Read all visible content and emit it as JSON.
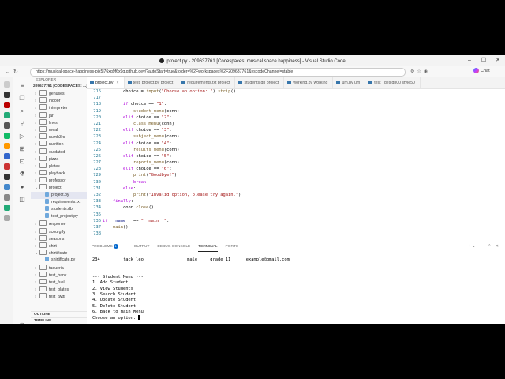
{
  "window": {
    "title": "project.py - 209637761 [Codespaces: musical space happiness] - Visual Studio Code",
    "url": "https://musical-space-happiness-pjx5j76xq9f6x9g.github.dev/?autoStart=true&folder=%2Fworkspaces%2F209637761&vscodeChannel=stable",
    "chat_label": "Chat"
  },
  "sidebar": {
    "header": "EXPLORER",
    "root": "209637761 [CODESPACES: ...]",
    "items": [
      {
        "label": "genuses",
        "type": "folder"
      },
      {
        "label": "indoor",
        "type": "folder"
      },
      {
        "label": "interpreter",
        "type": "folder"
      },
      {
        "label": "jar",
        "type": "folder"
      },
      {
        "label": "lines",
        "type": "folder"
      },
      {
        "label": "meal",
        "type": "folder"
      },
      {
        "label": "numb3rs",
        "type": "folder"
      },
      {
        "label": "nutrition",
        "type": "folder"
      },
      {
        "label": "outdated",
        "type": "folder"
      },
      {
        "label": "pizza",
        "type": "folder"
      },
      {
        "label": "plates",
        "type": "folder"
      },
      {
        "label": "playback",
        "type": "folder"
      },
      {
        "label": "professor",
        "type": "folder"
      },
      {
        "label": "project",
        "type": "folder-open"
      },
      {
        "label": "project.py",
        "type": "file",
        "selected": true
      },
      {
        "label": "requirements.txt",
        "type": "file"
      },
      {
        "label": "students.db",
        "type": "file"
      },
      {
        "label": "test_project.py",
        "type": "file"
      },
      {
        "label": "response",
        "type": "folder"
      },
      {
        "label": "scourgify",
        "type": "folder"
      },
      {
        "label": "seasons",
        "type": "folder"
      },
      {
        "label": "shirt",
        "type": "folder"
      },
      {
        "label": "shirtificate",
        "type": "folder-open"
      },
      {
        "label": "shirtificate.py",
        "type": "file"
      },
      {
        "label": "taqueria",
        "type": "folder"
      },
      {
        "label": "test_bank",
        "type": "folder"
      },
      {
        "label": "test_fuel",
        "type": "folder"
      },
      {
        "label": "test_plates",
        "type": "folder"
      },
      {
        "label": "test_twttr",
        "type": "folder"
      }
    ],
    "outline": "OUTLINE",
    "timeline": "TIMELINE"
  },
  "tabs": [
    {
      "label": "project.py",
      "active": true
    },
    {
      "label": "test_project.py  project"
    },
    {
      "label": "requirements.txt  project"
    },
    {
      "label": "students.db  project"
    },
    {
      "label": "working.py  working"
    },
    {
      "label": "um.py  um"
    },
    {
      "label": "test_  design00  style50"
    }
  ],
  "editor": {
    "lines": [
      {
        "n": "716",
        "html": "        choice = <span class=\"fn\">input</span>(<span class=\"str\">\"Choose an option: \"</span>).<span class=\"fn\">strip</span>()"
      },
      {
        "n": "717",
        "html": ""
      },
      {
        "n": "718",
        "html": "        <span class=\"kw\">if</span> choice == <span class=\"str\">\"1\"</span>:"
      },
      {
        "n": "719",
        "html": "            <span class=\"fn\">student_menu</span>(conn)"
      },
      {
        "n": "720",
        "html": "        <span class=\"kw\">elif</span> choice == <span class=\"str\">\"2\"</span>:"
      },
      {
        "n": "721",
        "html": "            <span class=\"fn\">class_menu</span>(conn)"
      },
      {
        "n": "722",
        "html": "        <span class=\"kw\">elif</span> choice == <span class=\"str\">\"3\"</span>:"
      },
      {
        "n": "723",
        "html": "            <span class=\"fn\">subject_menu</span>(conn)"
      },
      {
        "n": "724",
        "html": "        <span class=\"kw\">elif</span> choice == <span class=\"str\">\"4\"</span>:"
      },
      {
        "n": "725",
        "html": "            <span class=\"fn\">results_menu</span>(conn)"
      },
      {
        "n": "726",
        "html": "        <span class=\"kw\">elif</span> choice == <span class=\"str\">\"5\"</span>:"
      },
      {
        "n": "727",
        "html": "            <span class=\"fn\">reports_menu</span>(conn)"
      },
      {
        "n": "728",
        "html": "        <span class=\"kw\">elif</span> choice == <span class=\"str\">\"6\"</span>:"
      },
      {
        "n": "729",
        "html": "            <span class=\"fn\">print</span>(<span class=\"str\">\"Goodbye!\"</span>)"
      },
      {
        "n": "730",
        "html": "            <span class=\"kw\">break</span>"
      },
      {
        "n": "731",
        "html": "        <span class=\"kw\">else</span>:"
      },
      {
        "n": "732",
        "html": "            <span class=\"fn\">print</span>(<span class=\"str\">\"Invalid option, please try again.\"</span>)"
      },
      {
        "n": "733",
        "html": "    <span class=\"kw\">finally</span>:"
      },
      {
        "n": "734",
        "html": "        conn.<span class=\"fn\">close</span>()"
      },
      {
        "n": "735",
        "html": ""
      },
      {
        "n": "736",
        "html": "<span class=\"kw\">if</span> <span class=\"var\">__name__</span> == <span class=\"str\">\"__main__\"</span>:"
      },
      {
        "n": "737",
        "html": "    <span class=\"fn\">main</span>()"
      },
      {
        "n": "738",
        "html": ""
      }
    ]
  },
  "panel": {
    "tabs": [
      "PROBLEMS",
      "OUTPUT",
      "DEBUG CONSOLE",
      "TERMINAL",
      "PORTS"
    ],
    "active_tab": "TERMINAL",
    "problems_count": "1",
    "terminal_lines": [
      "",
      "234         jack leo                 male     grade 11      example@gmail.com",
      "",
      "",
      "--- Student Menu ---",
      "1. Add Student",
      "2. View Students",
      "3. Search Student",
      "4. Update Student",
      "5. Delete Student",
      "6. Back to Main Menu",
      "Choose an option: "
    ]
  }
}
